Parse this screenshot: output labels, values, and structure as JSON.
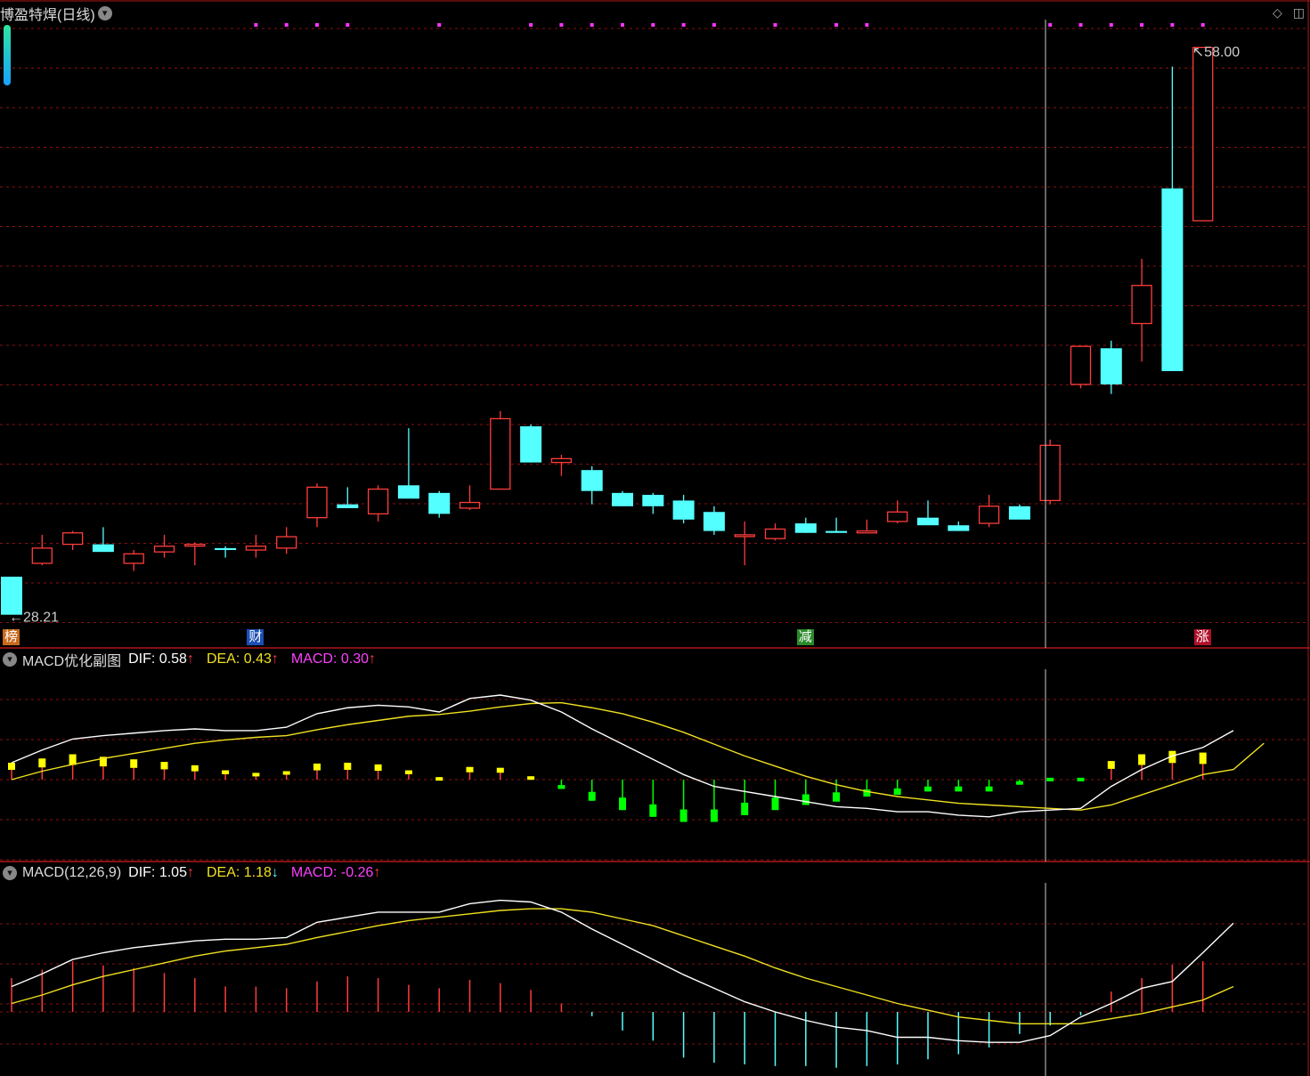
{
  "header": {
    "stock_name": "博盈特焊(日线)",
    "menu_icon": "chevron-down-icon"
  },
  "top_right_icons": [
    "diamond-icon",
    "window-icon"
  ],
  "price_labels": {
    "high": "58.00",
    "low": "28.21"
  },
  "event_tags": [
    {
      "text": "榜",
      "index": 0,
      "color": "#c8691c"
    },
    {
      "text": "财",
      "index": 8,
      "color": "#1c4fb4"
    },
    {
      "text": "减",
      "index": 26,
      "color": "#2a8a2a"
    },
    {
      "text": "涨",
      "index": 39,
      "color": "#b0102a"
    }
  ],
  "sub1": {
    "name": "MACD优化副图",
    "dif_label": "DIF: 0.58",
    "dea_label": "DEA: 0.43",
    "macd_label": "MACD: 0.30",
    "dif_arrow": "↑",
    "dea_arrow": "↑",
    "macd_arrow": "↑"
  },
  "sub2": {
    "name": "MACD(12,26,9)",
    "dif_label": "DIF: 1.05",
    "dea_label": "DEA: 1.18",
    "macd_label": "MACD: -0.26",
    "dif_arrow": "↑",
    "dea_arrow": "↓",
    "macd_arrow": "↑"
  },
  "colors": {
    "up": "#ff3c3c",
    "down": "#54ffff",
    "grid": "#8a1010",
    "dif": "#ffffff",
    "dea": "#f0e020",
    "macd_label": "#ff40ff",
    "pos_bar": "#ffff00",
    "neg_bar": "#00ff00"
  },
  "chart_data": [
    {
      "type": "candlestick",
      "title": "博盈特焊(日线)",
      "ylim": [
        28,
        59
      ],
      "candles": [
        {
          "o": 30.2,
          "h": 30.2,
          "l": 28.21,
          "c": 28.2
        },
        {
          "o": 30.9,
          "h": 32.4,
          "l": 30.8,
          "c": 31.7
        },
        {
          "o": 31.9,
          "h": 32.6,
          "l": 31.6,
          "c": 32.5
        },
        {
          "o": 31.9,
          "h": 32.8,
          "l": 31.6,
          "c": 31.5
        },
        {
          "o": 30.9,
          "h": 31.6,
          "l": 30.5,
          "c": 31.4
        },
        {
          "o": 31.5,
          "h": 32.4,
          "l": 31.2,
          "c": 31.8
        },
        {
          "o": 31.9,
          "h": 32.0,
          "l": 30.8,
          "c": 31.9
        },
        {
          "o": 31.7,
          "h": 31.8,
          "l": 31.2,
          "c": 31.6
        },
        {
          "o": 31.6,
          "h": 32.4,
          "l": 31.2,
          "c": 31.8
        },
        {
          "o": 31.7,
          "h": 32.8,
          "l": 31.4,
          "c": 32.3
        },
        {
          "o": 33.3,
          "h": 35.1,
          "l": 32.8,
          "c": 34.9
        },
        {
          "o": 34.0,
          "h": 34.9,
          "l": 33.8,
          "c": 33.8
        },
        {
          "o": 33.5,
          "h": 35.0,
          "l": 33.1,
          "c": 34.8
        },
        {
          "o": 35.0,
          "h": 38.0,
          "l": 34.7,
          "c": 34.3
        },
        {
          "o": 34.6,
          "h": 34.7,
          "l": 33.3,
          "c": 33.5
        },
        {
          "o": 33.8,
          "h": 35.0,
          "l": 33.7,
          "c": 34.1
        },
        {
          "o": 34.8,
          "h": 38.9,
          "l": 34.8,
          "c": 38.5
        },
        {
          "o": 38.1,
          "h": 38.2,
          "l": 36.2,
          "c": 36.2
        },
        {
          "o": 36.2,
          "h": 36.6,
          "l": 35.5,
          "c": 36.4
        },
        {
          "o": 35.8,
          "h": 36.0,
          "l": 34.0,
          "c": 34.7
        },
        {
          "o": 34.6,
          "h": 34.7,
          "l": 33.9,
          "c": 33.9
        },
        {
          "o": 34.5,
          "h": 34.6,
          "l": 33.5,
          "c": 33.9
        },
        {
          "o": 34.2,
          "h": 34.5,
          "l": 33.0,
          "c": 33.2
        },
        {
          "o": 33.6,
          "h": 33.9,
          "l": 32.4,
          "c": 32.6
        },
        {
          "o": 32.4,
          "h": 33.1,
          "l": 30.8,
          "c": 32.4
        },
        {
          "o": 32.2,
          "h": 33.0,
          "l": 32.1,
          "c": 32.7
        },
        {
          "o": 33.0,
          "h": 33.3,
          "l": 32.5,
          "c": 32.5
        },
        {
          "o": 32.6,
          "h": 33.3,
          "l": 32.5,
          "c": 32.5
        },
        {
          "o": 32.5,
          "h": 33.2,
          "l": 32.5,
          "c": 32.6
        },
        {
          "o": 33.1,
          "h": 34.2,
          "l": 33.0,
          "c": 33.6
        },
        {
          "o": 33.3,
          "h": 34.2,
          "l": 33.2,
          "c": 32.9
        },
        {
          "o": 32.9,
          "h": 33.1,
          "l": 32.6,
          "c": 32.6
        },
        {
          "o": 33.0,
          "h": 34.5,
          "l": 32.8,
          "c": 33.9
        },
        {
          "o": 33.9,
          "h": 34.0,
          "l": 33.5,
          "c": 33.2
        },
        {
          "o": 34.2,
          "h": 37.4,
          "l": 34.0,
          "c": 37.1
        },
        {
          "o": 40.3,
          "h": 41.6,
          "l": 40.1,
          "c": 42.3
        },
        {
          "o": 42.2,
          "h": 42.6,
          "l": 39.8,
          "c": 40.3
        },
        {
          "o": 43.5,
          "h": 46.9,
          "l": 41.5,
          "c": 45.5
        },
        {
          "o": 50.6,
          "h": 57.0,
          "l": 41.0,
          "c": 41.0
        },
        {
          "o": 48.9,
          "h": 58.0,
          "l": 48.9,
          "c": 58.0
        }
      ]
    },
    {
      "type": "bar+line",
      "title": "MACD优化副图",
      "series": [
        {
          "name": "DIF",
          "values": [
            0.2,
            0.35,
            0.48,
            0.52,
            0.55,
            0.58,
            0.6,
            0.58,
            0.58,
            0.62,
            0.78,
            0.85,
            0.88,
            0.86,
            0.8,
            0.96,
            1.0,
            0.94,
            0.8,
            0.6,
            0.42,
            0.24,
            0.06,
            -0.08,
            -0.14,
            -0.2,
            -0.26,
            -0.32,
            -0.34,
            -0.38,
            -0.38,
            -0.42,
            -0.44,
            -0.38,
            -0.36,
            -0.34,
            -0.08,
            0.12,
            0.28,
            0.38,
            0.58
          ]
        },
        {
          "name": "DEA",
          "values": [
            0.0,
            0.1,
            0.18,
            0.25,
            0.31,
            0.37,
            0.43,
            0.47,
            0.5,
            0.52,
            0.59,
            0.65,
            0.7,
            0.75,
            0.77,
            0.81,
            0.86,
            0.9,
            0.91,
            0.85,
            0.78,
            0.68,
            0.56,
            0.42,
            0.28,
            0.16,
            0.04,
            -0.06,
            -0.14,
            -0.2,
            -0.24,
            -0.28,
            -0.3,
            -0.32,
            -0.34,
            -0.36,
            -0.3,
            -0.18,
            -0.06,
            0.06,
            0.12,
            0.43
          ]
        },
        {
          "name": "MACD",
          "values": [
            0.2,
            0.25,
            0.3,
            0.27,
            0.24,
            0.21,
            0.17,
            0.11,
            0.08,
            0.1,
            0.19,
            0.2,
            0.18,
            0.11,
            0.03,
            0.15,
            0.14,
            0.04,
            -0.11,
            -0.25,
            -0.36,
            -0.44,
            -0.5,
            -0.5,
            -0.42,
            -0.36,
            -0.3,
            -0.26,
            -0.2,
            -0.18,
            -0.14,
            -0.14,
            -0.14,
            -0.06,
            -0.02,
            -0.02,
            0.22,
            0.3,
            0.34,
            0.32,
            0.3
          ]
        }
      ]
    },
    {
      "type": "bar+line",
      "title": "MACD(12,26,9)",
      "series": [
        {
          "name": "DIF",
          "values": [
            0.3,
            0.45,
            0.62,
            0.7,
            0.76,
            0.8,
            0.84,
            0.86,
            0.86,
            0.88,
            1.06,
            1.12,
            1.18,
            1.18,
            1.18,
            1.28,
            1.32,
            1.3,
            1.18,
            0.98,
            0.8,
            0.62,
            0.44,
            0.28,
            0.12,
            0.0,
            -0.1,
            -0.18,
            -0.22,
            -0.3,
            -0.3,
            -0.34,
            -0.36,
            -0.36,
            -0.28,
            -0.06,
            0.1,
            0.28,
            0.36,
            0.7,
            1.05
          ]
        },
        {
          "name": "DEA",
          "values": [
            0.1,
            0.2,
            0.32,
            0.42,
            0.5,
            0.58,
            0.66,
            0.72,
            0.76,
            0.8,
            0.88,
            0.95,
            1.02,
            1.08,
            1.12,
            1.16,
            1.2,
            1.22,
            1.22,
            1.18,
            1.1,
            1.02,
            0.9,
            0.78,
            0.66,
            0.52,
            0.4,
            0.3,
            0.2,
            0.1,
            0.02,
            -0.06,
            -0.1,
            -0.14,
            -0.14,
            -0.14,
            -0.08,
            -0.02,
            0.06,
            0.14,
            0.3
          ]
        },
        {
          "name": "MACD",
          "values": [
            0.4,
            0.5,
            0.6,
            0.55,
            0.52,
            0.46,
            0.4,
            0.3,
            0.3,
            0.28,
            0.36,
            0.42,
            0.4,
            0.32,
            0.28,
            0.38,
            0.34,
            0.26,
            0.1,
            -0.05,
            -0.22,
            -0.34,
            -0.54,
            -0.6,
            -0.62,
            -0.64,
            -0.64,
            -0.66,
            -0.64,
            -0.62,
            -0.56,
            -0.5,
            -0.42,
            -0.26,
            -0.16,
            -0.04,
            0.24,
            0.4,
            0.56,
            0.6,
            0.96
          ]
        }
      ]
    }
  ]
}
